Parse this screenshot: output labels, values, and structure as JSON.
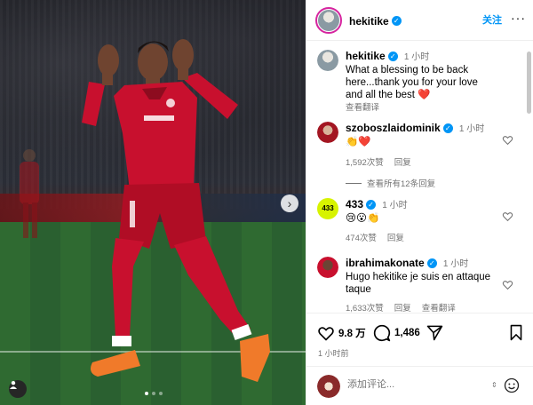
{
  "post": {
    "username": "hekitike",
    "follow_label": "关注",
    "more_label": "···",
    "caption_time": "1 小时",
    "caption_lines": [
      "What a blessing to be back",
      "here...thank you for your love",
      "and all the best ❤️"
    ],
    "translate_label": "查看翻译",
    "likes": "9.8 万",
    "comments_count": "1,486",
    "posted_ago": "1 小时前",
    "comment_placeholder": "添加评论..."
  },
  "comments": [
    {
      "user": "szoboszlaidominik",
      "time": "1 小时",
      "text": "👏❤️",
      "likes": "1,592次赞",
      "reply": "回复"
    },
    {
      "user": "433",
      "time": "1 小时",
      "text": "😢😮👏",
      "likes": "474次赞",
      "reply": "回复"
    },
    {
      "user": "ibrahimakonate",
      "time": "1 小时",
      "text": "Hugo hekitike je suis en attaque taque",
      "likes": "1,633次赞",
      "reply": "回复",
      "translate": "查看翻译"
    }
  ],
  "view_replies_label": "查看所有12条回复",
  "icons": {
    "verified": "verified-badge-icon",
    "heart": "heart-icon",
    "comment": "comment-icon",
    "share": "send-icon",
    "save": "bookmark-icon",
    "emoji": "emoji-icon",
    "next": "chevron-right-icon",
    "tag": "user-tag-icon"
  },
  "colors": {
    "accent": "#0095f6",
    "liverpool_red": "#c8102e"
  }
}
